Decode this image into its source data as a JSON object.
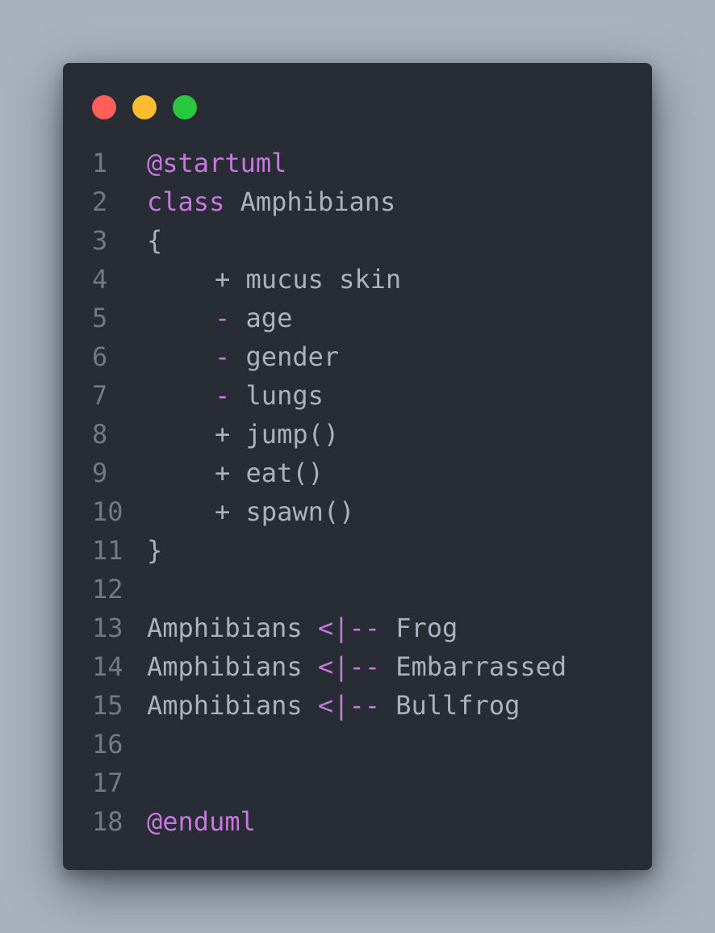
{
  "colors": {
    "background": "#a8b2bc",
    "window": "#282c35",
    "dot_red": "#ff5f57",
    "dot_yellow": "#febc2e",
    "dot_green": "#28c840",
    "keyword": "#c678dd",
    "text": "#abb2bf",
    "line_number": "#717a86"
  },
  "lines": [
    {
      "num": "1",
      "parts": [
        {
          "t": "@startuml",
          "kw": true
        }
      ]
    },
    {
      "num": "2",
      "parts": [
        {
          "t": "class",
          "kw": true
        },
        {
          "t": " Amphibians",
          "kw": false
        }
      ]
    },
    {
      "num": "3",
      "parts": [
        {
          "t": "{",
          "kw": false
        }
      ]
    },
    {
      "num": "4",
      "indent": true,
      "parts": [
        {
          "t": "+ mucus skin",
          "kw": false
        }
      ]
    },
    {
      "num": "5",
      "indent": true,
      "parts": [
        {
          "t": "-",
          "kw": true
        },
        {
          "t": " age",
          "kw": false
        }
      ]
    },
    {
      "num": "6",
      "indent": true,
      "parts": [
        {
          "t": "-",
          "kw": true
        },
        {
          "t": " gender",
          "kw": false
        }
      ]
    },
    {
      "num": "7",
      "indent": true,
      "parts": [
        {
          "t": "-",
          "kw": true
        },
        {
          "t": " lungs",
          "kw": false
        }
      ]
    },
    {
      "num": "8",
      "indent": true,
      "parts": [
        {
          "t": "+ jump()",
          "kw": false
        }
      ]
    },
    {
      "num": "9",
      "indent": true,
      "parts": [
        {
          "t": "+ eat()",
          "kw": false
        }
      ]
    },
    {
      "num": "10",
      "indent": true,
      "parts": [
        {
          "t": "+ spawn()",
          "kw": false
        }
      ]
    },
    {
      "num": "11",
      "parts": [
        {
          "t": "}",
          "kw": false
        }
      ]
    },
    {
      "num": "12",
      "parts": []
    },
    {
      "num": "13",
      "parts": [
        {
          "t": "Amphibians ",
          "kw": false
        },
        {
          "t": "<|--",
          "kw": true
        },
        {
          "t": " Frog",
          "kw": false
        }
      ]
    },
    {
      "num": "14",
      "parts": [
        {
          "t": "Amphibians ",
          "kw": false
        },
        {
          "t": "<|--",
          "kw": true
        },
        {
          "t": " Embarrassed",
          "kw": false
        }
      ]
    },
    {
      "num": "15",
      "parts": [
        {
          "t": "Amphibians ",
          "kw": false
        },
        {
          "t": "<|--",
          "kw": true
        },
        {
          "t": " Bullfrog",
          "kw": false
        }
      ]
    },
    {
      "num": "16",
      "parts": []
    },
    {
      "num": "17",
      "parts": []
    },
    {
      "num": "18",
      "parts": [
        {
          "t": "@enduml",
          "kw": true
        }
      ]
    }
  ]
}
